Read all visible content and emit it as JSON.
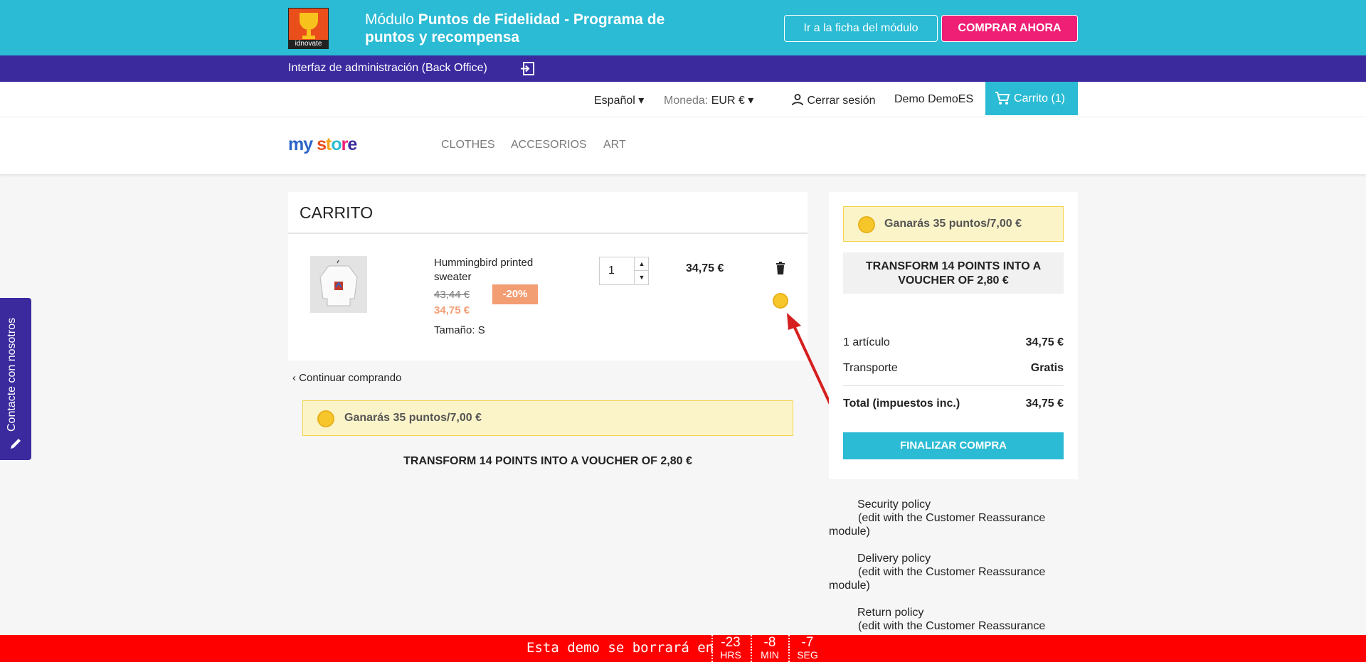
{
  "promo": {
    "logo_text": "idnovate",
    "title_prefix": "Módulo ",
    "title_bold": "Puntos de Fidelidad - Programa de puntos y recompensa",
    "ficha_button": "Ir a la ficha del módulo",
    "buy_button": "COMPRAR AHORA"
  },
  "backoffice": {
    "link": "Interfaz de administración (Back Office)"
  },
  "header": {
    "language": "Español",
    "currency_label": "Moneda:",
    "currency_value": "EUR €",
    "logout": "Cerrar sesión",
    "user": "Demo DemoES",
    "cart": "Carrito (1)"
  },
  "store": {
    "logo": "my store",
    "menu": [
      "CLOTHES",
      "ACCESORIOS",
      "ART"
    ]
  },
  "cart": {
    "title": "CARRITO",
    "product": {
      "name": "Hummingbird printed sweater",
      "old_price": "43,44 €",
      "discount": "-20%",
      "price": "34,75 €",
      "size_label": "Tamaño:",
      "size_value": "S",
      "quantity": "1",
      "line_total": "34,75 €"
    },
    "continue": "Continuar comprando",
    "earn": "Ganarás 35 puntos/7,00 €",
    "transform": "TRANSFORM 14 POINTS INTO A VOUCHER OF 2,80 €"
  },
  "summary": {
    "earn": "Ganarás 35 puntos/7,00 €",
    "transform": "TRANSFORM 14 POINTS INTO A VOUCHER OF 2,80 €",
    "items_label": "1 artículo",
    "items_value": "34,75 €",
    "shipping_label": "Transporte",
    "shipping_value": "Gratis",
    "total_label": "Total (impuestos inc.)",
    "total_value": "34,75 €",
    "checkout": "FINALIZAR COMPRA"
  },
  "reassurance": [
    {
      "title": "Security policy",
      "sub": "(edit with the Customer Reassurance module)"
    },
    {
      "title": "Delivery policy",
      "sub": "(edit with the Customer Reassurance module)"
    },
    {
      "title": "Return policy",
      "sub": "(edit with the Customer Reassurance"
    }
  ],
  "contact_tab": "Contacte con nosotros",
  "countdown": {
    "message": "Esta demo se borrará en",
    "hours": "-23",
    "hours_unit": "HRS",
    "minutes": "-8",
    "minutes_unit": "MIN",
    "seconds": "-7",
    "seconds_unit": "SEG"
  },
  "colors": {
    "accent": "#2bbbd4",
    "brand_purple": "#3a2a9e",
    "cta_pink": "#ee1f75",
    "countdown_red": "#ff0000"
  }
}
